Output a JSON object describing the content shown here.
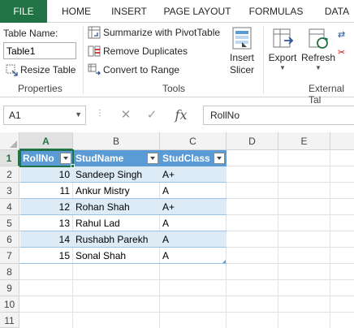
{
  "tabs": [
    "FILE",
    "HOME",
    "INSERT",
    "PAGE LAYOUT",
    "FORMULAS",
    "DATA"
  ],
  "ribbon": {
    "table_name_label": "Table Name:",
    "table_name_value": "Table1",
    "resize_table": "Resize Table",
    "properties_group": "Properties",
    "summarize_pivot": "Summarize with PivotTable",
    "remove_duplicates": "Remove Duplicates",
    "convert_range": "Convert to Range",
    "tools_group": "Tools",
    "insert_slicer_line1": "Insert",
    "insert_slicer_line2": "Slicer",
    "export": "Export",
    "refresh": "Refresh",
    "external_group": "External Tal"
  },
  "formula_bar": {
    "name_box": "A1",
    "cancel_symbol": "✕",
    "enter_symbol": "✓",
    "fx": "fx",
    "content": "RollNo"
  },
  "grid": {
    "columns": [
      "A",
      "B",
      "C",
      "D",
      "E"
    ],
    "rows": [
      "1",
      "2",
      "3",
      "4",
      "5",
      "6",
      "7",
      "8",
      "9",
      "10",
      "11"
    ],
    "headers": [
      "RollNo",
      "StudName",
      "StudClass"
    ],
    "data": [
      [
        "10",
        "Sandeep Singh",
        "A+"
      ],
      [
        "11",
        "Ankur Mistry",
        "A"
      ],
      [
        "12",
        "Rohan Shah",
        "A+"
      ],
      [
        "13",
        "Rahul Lad",
        "A"
      ],
      [
        "14",
        "Rushabh Parekh",
        "A"
      ],
      [
        "15",
        "Sonal Shah",
        "A"
      ]
    ]
  },
  "colors": {
    "file_tab": "#217346",
    "table_header": "#5b9bd5",
    "band": "#ddebf7",
    "selection": "#217346"
  },
  "icons": {
    "resize": "resize-table-icon",
    "pivot": "pivot-table-icon",
    "dedupe": "remove-duplicates-icon",
    "convert": "convert-range-icon",
    "slicer": "slicer-icon",
    "export": "export-icon",
    "refresh": "refresh-icon"
  }
}
